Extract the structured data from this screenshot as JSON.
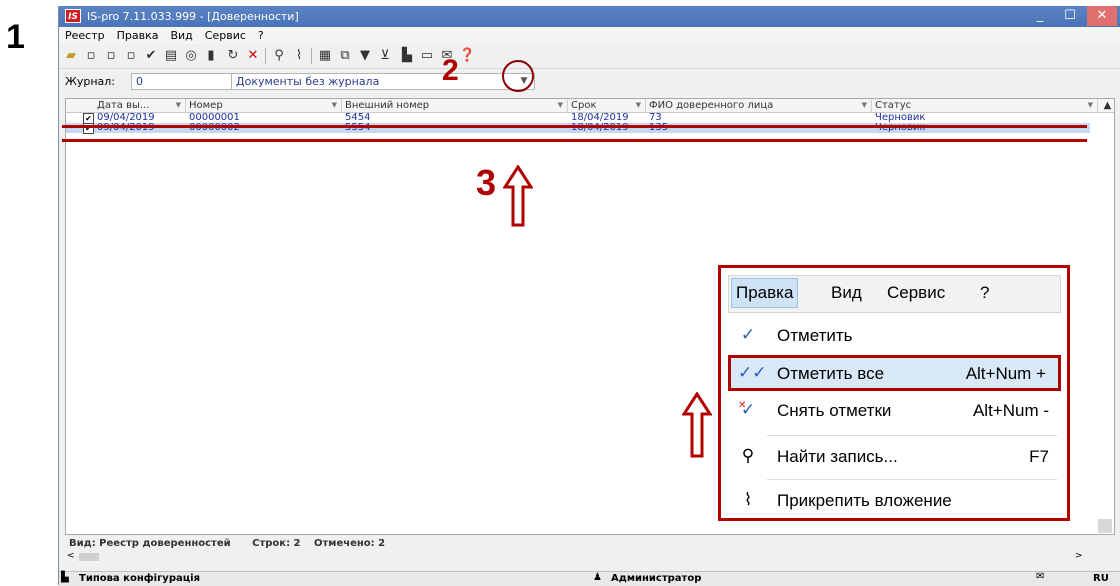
{
  "annotations": {
    "step1": "1",
    "step2": "2",
    "step3": "3"
  },
  "window": {
    "title": "IS-pro 7.11.033.999 - [Доверенности]",
    "logo": "IS",
    "menu": [
      "Реестр",
      "Правка",
      "Вид",
      "Сервис",
      "?"
    ]
  },
  "journal": {
    "label": "Журнал:",
    "code": "0",
    "name": "Документы без журнала"
  },
  "grid": {
    "columns": [
      "Дата вы...",
      "Номер",
      "Внешний номер",
      "Срок",
      "ФИО доверенного лица",
      "Статус"
    ],
    "rows": [
      {
        "checked": true,
        "date": "09/04/2019",
        "number": "00000001",
        "ext": "5454",
        "term": "18/04/2019",
        "person": "73",
        "status": "Черновик"
      },
      {
        "checked": true,
        "date": "09/04/2019",
        "number": "00000002",
        "ext": "5554",
        "term": "18/04/2019",
        "person": "135",
        "status": "Черновик"
      }
    ]
  },
  "status_line": {
    "view": "Вид: Реестр доверенностей",
    "rows": "Строк: 2",
    "marked": "Отмечено: 2"
  },
  "bottom_bar": {
    "config": "Типова конфігурація",
    "user": "Администратор",
    "lang": "RU"
  },
  "popup": {
    "menu": [
      "Правка",
      "Вид",
      "Сервис",
      "?"
    ],
    "items": [
      {
        "label": "Отметить",
        "shortcut": "",
        "icon": "check-icon"
      },
      {
        "label": "Отметить все",
        "shortcut": "Alt+Num +",
        "icon": "double-check-icon"
      },
      {
        "label": "Снять отметки",
        "shortcut": "Alt+Num -",
        "icon": "uncheck-icon"
      },
      {
        "label": "Найти запись...",
        "shortcut": "F7",
        "icon": "search-icon"
      },
      {
        "label": "Прикрепить вложение",
        "shortcut": "",
        "icon": "paperclip-icon"
      }
    ]
  },
  "colors": {
    "annotation_red": "#b00000",
    "title_bar": "#4a74b8",
    "link_blue": "#1f2fa0"
  }
}
